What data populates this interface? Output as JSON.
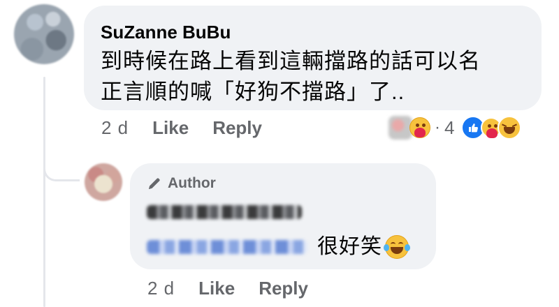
{
  "main_comment": {
    "author_name": "SuZanne BuBu",
    "text_line1": "到時候在路上看到這輛擋路的話可以名",
    "text_line2": "正言順的喊「好狗不擋路」了..",
    "timestamp": "2 d",
    "like_label": "Like",
    "reply_label": "Reply",
    "reaction_separator": "·",
    "reaction_count": "4",
    "reaction_icons": [
      "care-emoji",
      "like-emoji",
      "care-emoji",
      "haha-emoji"
    ]
  },
  "author_reply": {
    "badge_label": "Author",
    "text": "很好笑",
    "timestamp": "2 d",
    "like_label": "Like",
    "reply_label": "Reply",
    "emoji": "laugh-tears-emoji"
  },
  "colors": {
    "bubble_bg": "#f0f2f5",
    "secondary_text": "#65676b",
    "like_blue": "#1877f2",
    "emoji_yellow": "#f7c23d"
  }
}
